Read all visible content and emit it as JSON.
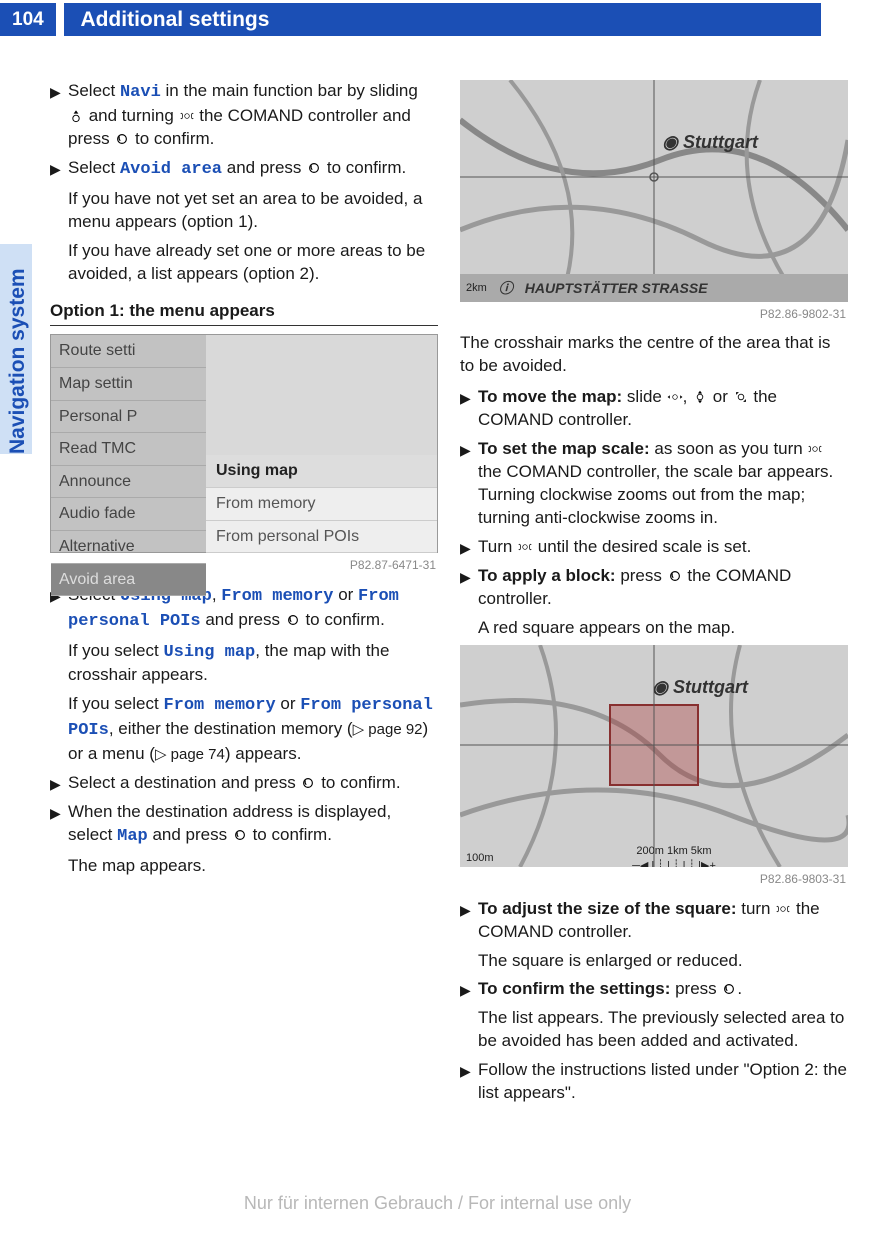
{
  "header": {
    "page_number": "104",
    "title": "Additional settings"
  },
  "side_tab": "Navigation system",
  "left_column": {
    "step1": {
      "pre": "Select ",
      "term": "Navi",
      "post": " in the main function bar by sliding ",
      "post2": " and turning ",
      "post3": " the COMAND controller and press ",
      "post4": " to confirm."
    },
    "step2": {
      "pre": "Select ",
      "term": "Avoid area",
      "post": " and press ",
      "post2": " to confirm."
    },
    "step2_sub1": "If you have not yet set an area to be avoided, a menu appears (option 1).",
    "step2_sub2": "If you have already set one or more areas to be avoided, a list appears (option 2).",
    "heading1": "Option 1: the menu appears",
    "menu_image": {
      "left": [
        "Route setti",
        "Map settin",
        "Personal P",
        "Read TMC",
        "Announce",
        "Audio fade",
        "Alternative",
        "Avoid area"
      ],
      "right": [
        "Using map",
        "From memory",
        "From personal POIs"
      ],
      "caption": "P82.87-6471-31"
    },
    "step3": {
      "pre": "Select ",
      "term1": "Using map",
      "sep1": ", ",
      "term2": "From memory",
      "sep2": " or ",
      "term3": "From personal POIs",
      "post": " and press ",
      "post2": " to confirm."
    },
    "step3_sub1a": "If you select ",
    "step3_sub1_term": "Using map",
    "step3_sub1b": ", the map with the crosshair appears.",
    "step3_sub2a": "If you select ",
    "step3_sub2_term1": "From memory",
    "step3_sub2_mid": " or ",
    "step3_sub2_term2": "From personal POIs",
    "step3_sub2b": ", either the destination memory (",
    "step3_sub2_xref1": "▷ page 92",
    "step3_sub2c": ") or a menu (",
    "step3_sub2_xref2": "▷ page 74",
    "step3_sub2d": ") appears.",
    "step4": {
      "pre": "Select a destination and press ",
      "post": " to confirm."
    },
    "step5": {
      "pre": "When the destination address is displayed, select ",
      "term": "Map",
      "post": " and press ",
      "post2": " to confirm."
    },
    "step5_sub": "The map appears."
  },
  "right_column": {
    "map1": {
      "city": "Stuttgart",
      "street": "HAUPTSTÄTTER STRASSE",
      "scale": "2km",
      "caption": "P82.86-9802-31"
    },
    "intro": "The crosshair marks the centre of the area that is to be avoided.",
    "step1": {
      "label": "To move the map:",
      "pre": " slide ",
      "mid1": ", ",
      "mid2": " or ",
      "post": " the COMAND controller."
    },
    "step2": {
      "label": "To set the map scale:",
      "text": " as soon as you turn ",
      "post": " the COMAND controller, the scale bar appears. Turning clockwise zooms out from the map; turning anti-clockwise zooms in."
    },
    "step3": {
      "pre": "Turn ",
      "post": " until the desired scale is set."
    },
    "step4": {
      "label": "To apply a block:",
      "pre": " press ",
      "post": " the COMAND controller."
    },
    "step4_sub": "A red square appears on the map.",
    "map2": {
      "city": "Stuttgart",
      "scale_left": "100m",
      "scale_ticks": "200m   1km    5km",
      "caption": "P82.86-9803-31"
    },
    "step5": {
      "label": "To adjust the size of the square:",
      "pre": " turn ",
      "post": " the COMAND controller."
    },
    "step5_sub": "The square is enlarged or reduced.",
    "step6": {
      "label": "To confirm the settings:",
      "pre": " press ",
      "post": "."
    },
    "step6_sub": "The list appears. The previously selected area to be avoided has been added and activated.",
    "step7": "Follow the instructions listed under \"Option 2: the list appears\"."
  },
  "footer": "Nur für internen Gebrauch / For internal use only"
}
